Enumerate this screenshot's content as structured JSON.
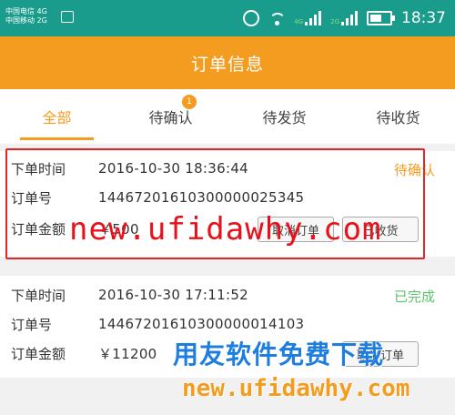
{
  "status_bar": {
    "carrier1": "中国电信 4G",
    "carrier2": "中国移动 2G",
    "net1": "4G",
    "net2": "2G",
    "time": "18:37"
  },
  "header": {
    "title": "订单信息"
  },
  "tabs": [
    {
      "label": "全部",
      "active": true
    },
    {
      "label": "待确认",
      "badge": "1"
    },
    {
      "label": "待发货"
    },
    {
      "label": "待收货"
    }
  ],
  "orders": [
    {
      "time_label": "下单时间",
      "time": "2016-10-30 18:36:44",
      "status": "待确认",
      "status_color": "#f39c1f",
      "no_label": "订单号",
      "no": "14467201610300000025345",
      "amount_label": "订单金额",
      "amount": "￥500",
      "btn1": "取消订单",
      "btn2": "已收货"
    },
    {
      "time_label": "下单时间",
      "time": "2016-10-30 17:11:52",
      "status": "已完成",
      "status_color": "#5cc46e",
      "no_label": "订单号",
      "no": "14467201610300000014103",
      "amount_label": "订单金额",
      "amount": "￥11200",
      "btn1": "取消订单"
    }
  ],
  "watermark": {
    "url_red": "new.ufidawhy.com",
    "brand_cn": "用友软件免费下载",
    "url_bottom": "new.ufidawhy.com"
  }
}
